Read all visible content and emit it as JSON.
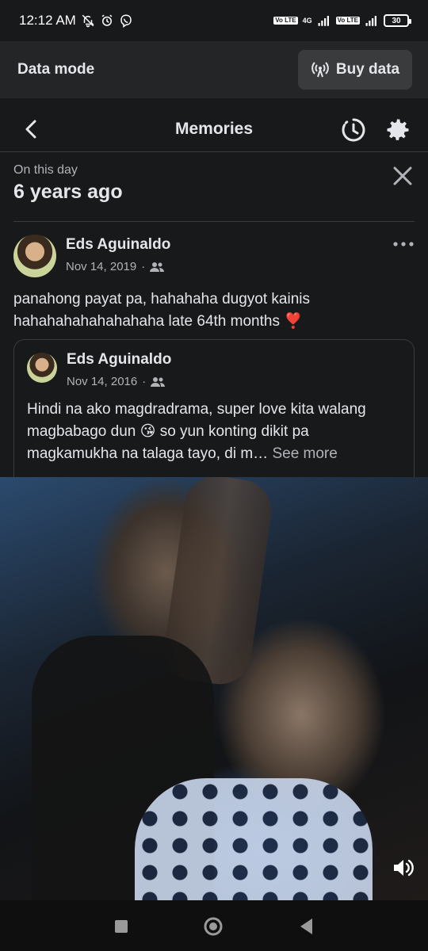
{
  "status_bar": {
    "time": "12:12 AM",
    "network": "4G",
    "volte_label": "Vo LTE",
    "battery": "30",
    "icons": [
      "mute-icon",
      "alarm-icon",
      "viber-icon",
      "signal-icon",
      "signal-icon",
      "battery-icon"
    ]
  },
  "data_banner": {
    "label": "Data mode",
    "button_label": "Buy data",
    "button_icon": "broadcast-icon"
  },
  "header": {
    "title": "Memories",
    "icons": [
      "back-icon",
      "history-icon",
      "gear-icon"
    ]
  },
  "memory": {
    "label": "On this day",
    "years": "6 years ago"
  },
  "post": {
    "author": "Eds Aguinaldo",
    "date": "Nov 14, 2019",
    "separator": "·",
    "audience_icon": "friends-icon",
    "text": "panahong payat pa, hahahaha dugyot kainis hahahahahahahahaha late 64th months ❣️"
  },
  "shared_post": {
    "author": "Eds Aguinaldo",
    "date": "Nov 14, 2016",
    "separator": "·",
    "audience_icon": "friends-icon",
    "text": "Hindi na ako magdradrama, super love kita walang magbabago dun 😘 so yun konting dikit pa magkamukha na talaga tayo, di m…",
    "see_more": "See more"
  },
  "colors": {
    "background": "#18191a",
    "surface": "#242526",
    "button": "#3a3b3c",
    "text_primary": "#e4e6eb",
    "text_secondary": "#b0b3b8"
  }
}
